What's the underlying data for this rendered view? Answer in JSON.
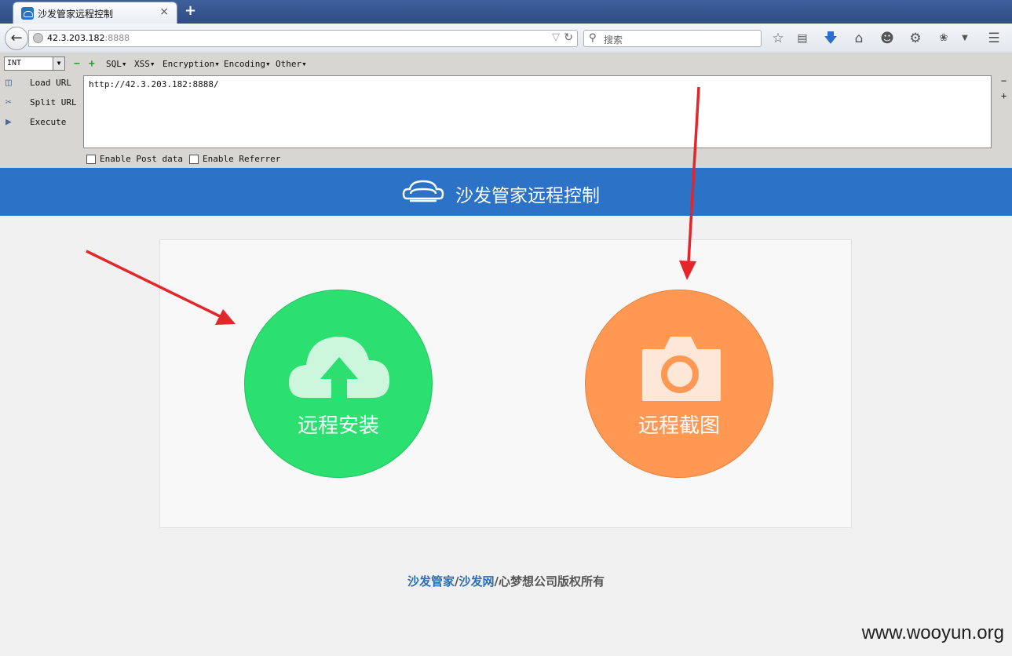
{
  "browser": {
    "tab_title": "沙发管家远程控制",
    "new_tab": "+",
    "close": "×",
    "url_host": "42.3.203.182",
    "url_port": ":8888",
    "search_placeholder": "搜索"
  },
  "hackbar": {
    "type_select": "INT",
    "menus": [
      "SQL▾",
      "XSS▾",
      "Encryption▾",
      "Encoding▾",
      "Other▾"
    ],
    "load_url": "Load URL",
    "split_url": "Split URL",
    "execute": "Execute",
    "url_value": "http://42.3.203.182:8888/",
    "enable_post": "Enable Post data",
    "enable_referrer": "Enable Referrer"
  },
  "site": {
    "header_title": "沙发管家远程控制",
    "install_label": "远程安装",
    "screenshot_label": "远程截图",
    "footer_link1": "沙发管家",
    "footer_sep1": "/",
    "footer_link2": "沙发网",
    "footer_rest": "/心梦想公司版权所有"
  },
  "watermark": "www.wooyun.org",
  "colors": {
    "header_blue": "#2c72c7",
    "install_green": "#2bdf70",
    "screenshot_orange": "#fe9852",
    "arrow_red": "#e3262a"
  }
}
